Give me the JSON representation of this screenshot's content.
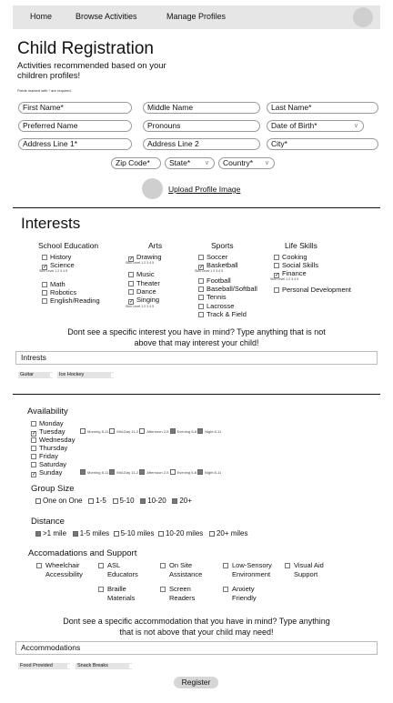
{
  "nav": {
    "home": "Home",
    "browse": "Browse Activities",
    "manage": "Manage Profiles"
  },
  "header": {
    "title": "Child Registration",
    "subtitle_1": "Activities recommended based on your",
    "subtitle_2": "children profiles!",
    "required_note": "Fields marked with * are required."
  },
  "form": {
    "first": "First Name*",
    "middle": "Middle Name",
    "last": "Last Name*",
    "preferred": "Preferred Name",
    "pronouns": "Pronouns",
    "dob": "Date of Birth*",
    "addr1": "Address Line 1*",
    "addr2": "Address Line 2",
    "city": "City*",
    "zip": "Zip Code*",
    "state": "State*",
    "country": "Country*",
    "upload": "Upload Profile Image"
  },
  "interests": {
    "title": "Interests",
    "school": {
      "title": "School Education",
      "items": [
        "History",
        "Science",
        "Math",
        "Robotics",
        "English/Reading"
      ],
      "skill": "Skill Level 1 2 3 4 5"
    },
    "arts": {
      "title": "Arts",
      "items": [
        "Drawing",
        "Music",
        "Theater",
        "Dance",
        "Singing"
      ],
      "skill_1": "Skill Level 1 2 3 4 5",
      "skill_2": "Skill Level 1 2 3 4 5"
    },
    "sports": {
      "title": "Sports",
      "items": [
        "Soccer",
        "Basketball",
        "Football",
        "Baseball/Softball",
        "Tennis",
        "Lacrosse",
        "Track & Field"
      ],
      "skill": "Skill Level 1 2 3 4 5"
    },
    "life": {
      "title": "Life Skills",
      "items": [
        "Cooking",
        "Social Skills",
        "Finance",
        "Personal Development"
      ],
      "skill": "Skill Level 1 2 3 4 5"
    },
    "prompt_1": "Dont see a specific interest you have in mind? Type anything that is not",
    "prompt_2": "above that may interest your child!",
    "input": "Intrests",
    "tags": [
      "Guitar",
      "Ice Hockey"
    ]
  },
  "availability": {
    "title": "Availability",
    "days": [
      "Monday",
      "Tuesday",
      "Wednesday",
      "Thursday",
      "Friday",
      "Saturday",
      "Sunday"
    ],
    "slots": [
      "Morning 8-11",
      "Mid-Day 11-2",
      "Afternoon 2-5",
      "Evening 5-8",
      "Night 8-11"
    ]
  },
  "group": {
    "title": "Group Size",
    "options": [
      "One on One",
      "1-5",
      "5-10",
      "10-20",
      "20+"
    ]
  },
  "distance": {
    "title": "Distance",
    "options": [
      ">1 mile",
      "1-5 miles",
      "5-10 miles",
      "10-20 miles",
      "20+ miles"
    ]
  },
  "accom": {
    "title": "Accomadations and Support",
    "wheel_1": "Wheelchair",
    "wheel_2": "Accessibility",
    "asl_1": "ASL",
    "asl_2": "Educators",
    "onsite_1": "On Site",
    "onsite_2": "Assistance",
    "lowsens_1": "Low-Sensory",
    "lowsens_2": "Environment",
    "visual_1": "Visual Aid",
    "visual_2": "Support",
    "braille_1": "Braille",
    "braille_2": "Materials",
    "screen_1": "Screen",
    "screen_2": "Readers",
    "anxiety_1": "Anxiety",
    "anxiety_2": "Friendly",
    "prompt_1": "Dont see a specific accommodation that you have in mind? Type anything",
    "prompt_2": "that is not above that your child may need!",
    "input": "Accommodations",
    "tags": [
      "Food Provided",
      "Snack Breaks"
    ]
  },
  "register": "Register"
}
